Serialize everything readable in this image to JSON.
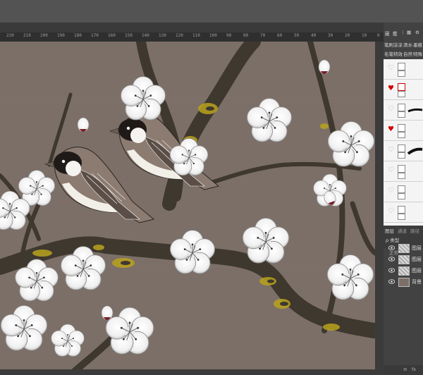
{
  "ruler": {
    "ticks": [
      "220",
      "210",
      "200",
      "190",
      "180",
      "170",
      "160",
      "150",
      "140",
      "130",
      "120",
      "110",
      "100",
      "90",
      "80",
      "70",
      "60",
      "50",
      "40",
      "30",
      "20",
      "10",
      "0"
    ]
  },
  "panel": {
    "top_icons": [
      "圖",
      "鑑",
      "⋮",
      "▦",
      "⚙"
    ],
    "brush_tabs": [
      "笔刷",
      "涂涂",
      "清水",
      "墨痕"
    ],
    "brush_subtabs": [
      "毛笔",
      "特效",
      "自然",
      "特殊"
    ],
    "layers_tabs": [
      "图层",
      "通道",
      "路径"
    ],
    "filter_label": "ρ 类型",
    "blend_label": "正常",
    "layers": [
      {
        "name": "图层",
        "visible": true
      },
      {
        "name": "图层",
        "visible": true
      },
      {
        "name": "图层",
        "visible": true
      },
      {
        "name": "背景",
        "visible": true
      }
    ],
    "bottom_icons": [
      "⊝",
      "fx"
    ]
  },
  "colors": {
    "canvas": "#7c6f68",
    "heart": "#d20000",
    "gold": "#b9a21d"
  }
}
